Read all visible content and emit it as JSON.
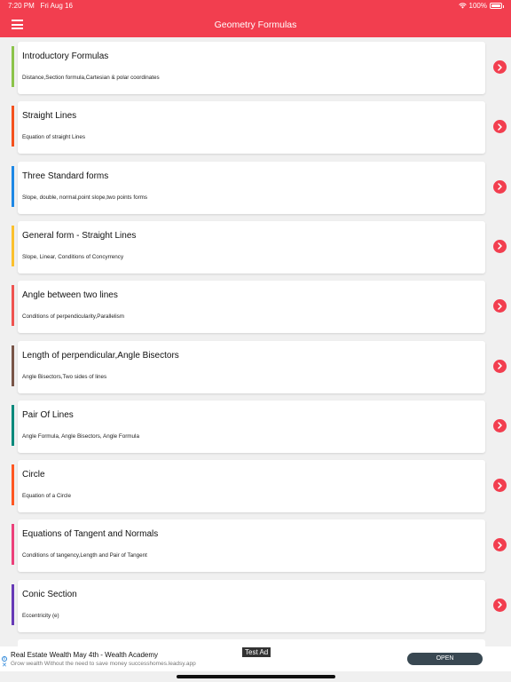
{
  "status": {
    "time": "7:20 PM",
    "date": "Fri Aug 16",
    "battery": "100%",
    "battery_level": 1.0
  },
  "header": {
    "title": "Geometry Formulas"
  },
  "items": [
    {
      "title": "Introductory Formulas",
      "subtitle": "Distance,Section formula,Cartesian & polar coordinates",
      "accent": "#8bc34a"
    },
    {
      "title": "Straight Lines",
      "subtitle": "Equation of straight Lines",
      "accent": "#f4511e"
    },
    {
      "title": "Three Standard forms",
      "subtitle": "Slope, double, normal,point slope,two points forms",
      "accent": "#1e88e5"
    },
    {
      "title": "General form - Straight Lines",
      "subtitle": "Slope, Linear, Conditions of Concyrrency",
      "accent": "#fbc02d"
    },
    {
      "title": "Angle between two lines",
      "subtitle": "Conditions of perpendicularity,Parallelism",
      "accent": "#ef5350"
    },
    {
      "title": "Length of perpendicular,Angle Bisectors",
      "subtitle": "Angle Bisectors,Two sides of lines",
      "accent": "#795548"
    },
    {
      "title": "Pair Of Lines",
      "subtitle": "Angle Formula, Angle Bisectors, Angle Formula",
      "accent": "#00897b"
    },
    {
      "title": "Circle",
      "subtitle": "Equation of a Circle",
      "accent": "#ff5722"
    },
    {
      "title": "Equations of Tangent and Normals",
      "subtitle": "Conditions of tangency,Length and Pair of Tangent",
      "accent": "#ec407a"
    },
    {
      "title": "Conic Section",
      "subtitle": "Eccentricity (e)",
      "accent": "#673ab7"
    }
  ],
  "ad": {
    "badge": "Test Ad",
    "title": "Real Estate Wealth May 4th - Wealth Academy",
    "description": "Grow wealth Without the need to save money successhomes.leadsy.app",
    "cta": "OPEN"
  },
  "colors": {
    "primary": "#f23e4f",
    "background": "#f0f0f0",
    "ad_button": "#394852"
  }
}
